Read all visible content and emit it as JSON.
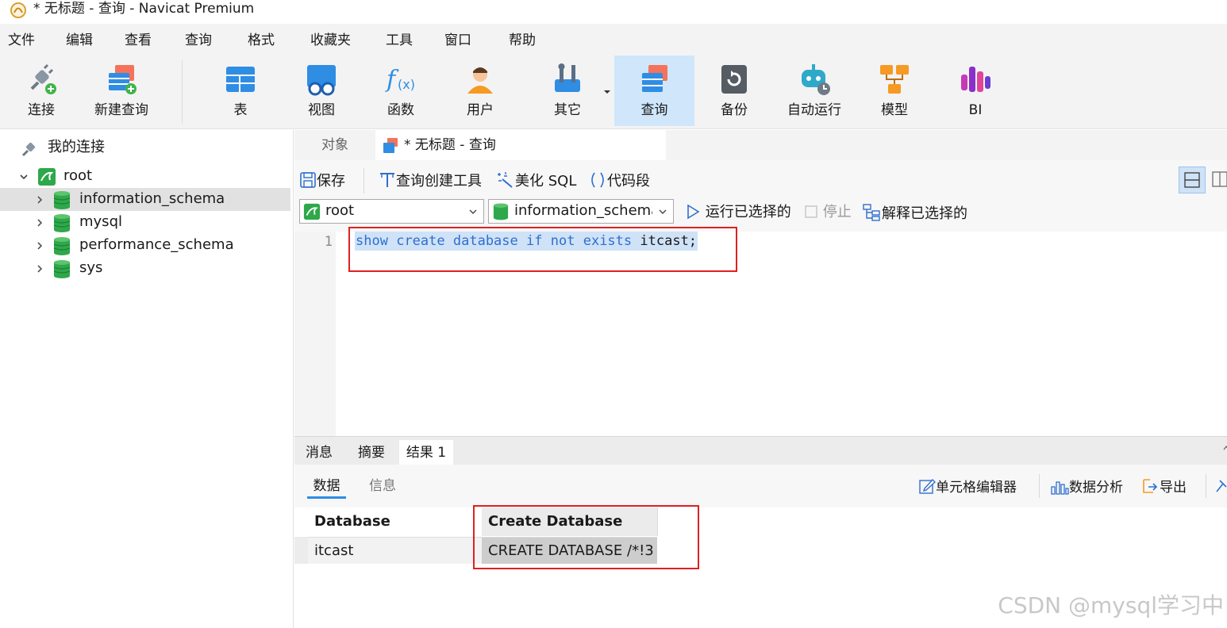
{
  "window": {
    "title": "* 无标题 - 查询 - Navicat Premium"
  },
  "menu": [
    "文件",
    "编辑",
    "查看",
    "查询",
    "格式",
    "收藏夹",
    "工具",
    "窗口",
    "帮助"
  ],
  "toolbar": {
    "connect": "连接",
    "new_query": "新建查询",
    "table": "表",
    "view": "视图",
    "function": "函数",
    "user": "用户",
    "other": "其它",
    "query": "查询",
    "backup": "备份",
    "automation": "自动运行",
    "model": "模型",
    "bi": "BI"
  },
  "sidebar": {
    "header": "我的连接",
    "connection": "root",
    "databases": [
      "information_schema",
      "mysql",
      "performance_schema",
      "sys"
    ],
    "selected": "information_schema"
  },
  "tabs": {
    "objects": "对象",
    "query_tab": "* 无标题 - 查询"
  },
  "query_toolbar": {
    "save": "保存",
    "query_builder": "查询创建工具",
    "beautify": "美化 SQL",
    "snippet": "代码段",
    "connection_select": "root",
    "database_select": "information_schema",
    "run_selected": "运行已选择的",
    "stop": "停止",
    "explain_selected": "解释已选择的"
  },
  "editor": {
    "line_number": "1",
    "sql": "show create database if not exists itcast;",
    "tokens": [
      "show",
      "create",
      "database",
      "if",
      "not",
      "exists",
      "itcast;"
    ]
  },
  "result_tabs": [
    "消息",
    "摘要",
    "结果 1"
  ],
  "result_subtabs": {
    "data": "数据",
    "info": "信息"
  },
  "result_tools": {
    "cell_editor": "单元格编辑器",
    "data_analysis": "数据分析",
    "export": "导出"
  },
  "grid": {
    "columns": [
      "Database",
      "Create Database"
    ],
    "rows": [
      [
        "itcast",
        "CREATE DATABASE /*!3"
      ]
    ]
  },
  "watermark": "CSDN @mysql学习中"
}
